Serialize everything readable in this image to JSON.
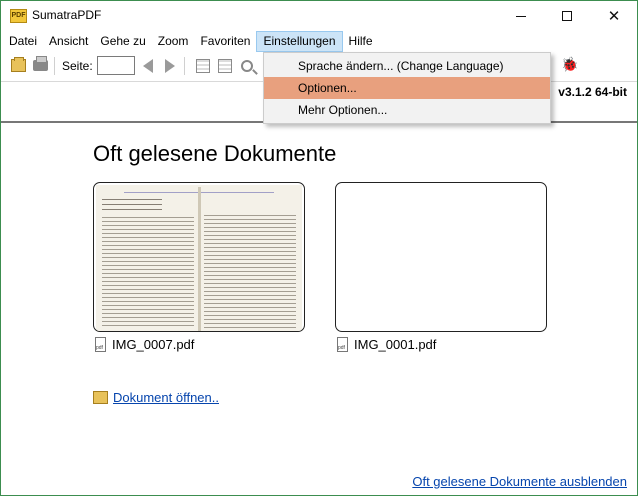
{
  "window": {
    "title": "SumatraPDF",
    "app_icon_text": "PDF"
  },
  "menubar": {
    "items": [
      {
        "label": "Datei"
      },
      {
        "label": "Ansicht"
      },
      {
        "label": "Gehe zu"
      },
      {
        "label": "Zoom"
      },
      {
        "label": "Favoriten"
      },
      {
        "label": "Einstellungen"
      },
      {
        "label": "Hilfe"
      }
    ]
  },
  "toolbar": {
    "page_label": "Seite:",
    "page_value": ""
  },
  "version": "v3.1.2 64-bit",
  "main": {
    "title": "Oft gelesene Dokumente",
    "documents": [
      {
        "name": "IMG_0007.pdf"
      },
      {
        "name": "IMG_0001.pdf"
      }
    ],
    "open_document": "Dokument öffnen..",
    "hide_link": "Oft gelesene Dokumente ausblenden"
  },
  "dropdown": {
    "items": [
      {
        "label": "Sprache ändern... (Change Language)"
      },
      {
        "label": "Optionen..."
      },
      {
        "label": "Mehr Optionen..."
      }
    ],
    "highlighted": "Optionen..."
  },
  "colors": {
    "highlight": "#e8a07e",
    "link": "#0645ad",
    "menu_active": "#cce4f7"
  }
}
